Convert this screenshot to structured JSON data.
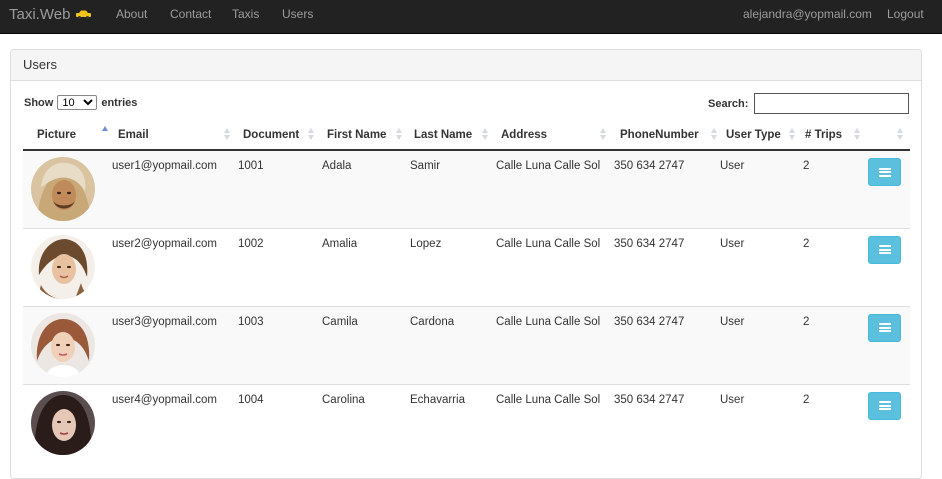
{
  "navbar": {
    "brand": "Taxi.Web",
    "links": {
      "about": "About",
      "contact": "Contact",
      "taxis": "Taxis",
      "users": "Users"
    },
    "user_email": "alejandra@yopmail.com",
    "logout": "Logout"
  },
  "panel": {
    "title": "Users",
    "show_label": "Show",
    "entries_label": "entries",
    "page_size": "10",
    "search_label": "Search:",
    "search_value": ""
  },
  "table": {
    "headers": {
      "picture": "Picture",
      "email": "Email",
      "document": "Document",
      "first_name": "First Name",
      "last_name": "Last Name",
      "address": "Address",
      "phone": "PhoneNumber",
      "user_type": "User Type",
      "trips": "# Trips"
    },
    "rows": [
      {
        "email": "user1@yopmail.com",
        "document": "1001",
        "first_name": "Adala",
        "last_name": "Samir",
        "address": "Calle Luna Calle Sol",
        "phone": "350 634 2747",
        "user_type": "User",
        "trips": "2"
      },
      {
        "email": "user2@yopmail.com",
        "document": "1002",
        "first_name": "Amalia",
        "last_name": "Lopez",
        "address": "Calle Luna Calle Sol",
        "phone": "350 634 2747",
        "user_type": "User",
        "trips": "2"
      },
      {
        "email": "user3@yopmail.com",
        "document": "1003",
        "first_name": "Camila",
        "last_name": "Cardona",
        "address": "Calle Luna Calle Sol",
        "phone": "350 634 2747",
        "user_type": "User",
        "trips": "2"
      },
      {
        "email": "user4@yopmail.com",
        "document": "1004",
        "first_name": "Carolina",
        "last_name": "Echavarria",
        "address": "Calle Luna Calle Sol",
        "phone": "350 634 2747",
        "user_type": "User",
        "trips": "2"
      }
    ]
  },
  "colors": {
    "navbar_bg": "#222222",
    "nav_text": "#9d9d9d",
    "action_button": "#5bc0de",
    "sort_active": "#6f8fc8"
  },
  "icons": {
    "taxi": "taxi-icon",
    "row_action": "menu-icon",
    "sort": "sort-icon"
  }
}
